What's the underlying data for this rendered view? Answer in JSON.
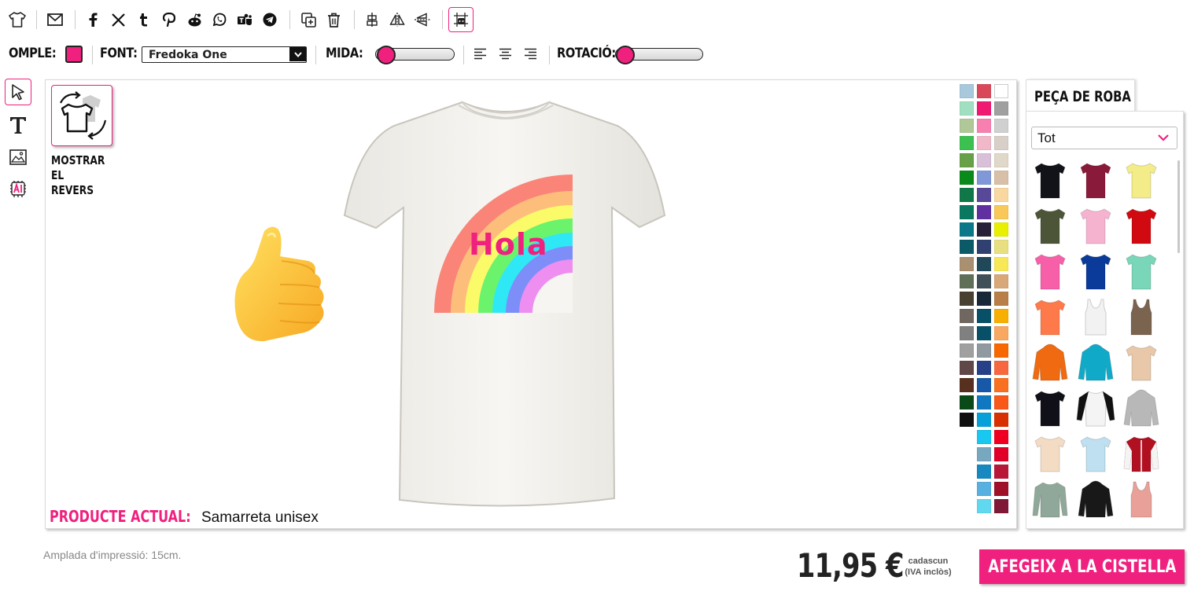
{
  "toolbar2": {
    "fill_label": "OMPLE:",
    "fill_color": "#f0207f",
    "font_label": "FONT:",
    "font_value": "Fredoka One",
    "size_label": "MIDA:",
    "rotation_label": "ROTACIÓ:"
  },
  "canvas": {
    "show_back_label_1": "MOSTRAR",
    "show_back_label_2": "EL REVERS",
    "design_text": "Hola",
    "current_product_label": "PRODUCTE ACTUAL:",
    "current_product_name": "Samarreta unisex"
  },
  "swatches": {
    "col1": [
      "#a8c8dc",
      "#a0e0c0",
      "#b0c898",
      "#3cc050",
      "#68a048",
      "#0a8a1a",
      "#107848",
      "#0a7860",
      "#0a7888",
      "#0a5a68",
      "#a89070",
      "#607058",
      "#484030",
      "#706860",
      "#808080",
      "#a0a0a0",
      "#604848",
      "#583020",
      "#0a4a18",
      "#101010"
    ],
    "col2": [
      "#d84858",
      "#f01870",
      "#f880b0",
      "#f0b8c8",
      "#d8c0d8",
      "#8098d8",
      "#584898",
      "#6030a0",
      "#282038",
      "#304070",
      "#204858",
      "#405058",
      "#182838",
      "#085068",
      "#085068",
      "#9098a0",
      "#284088",
      "#1858a8",
      "#1078c0",
      "#08a0d8",
      "#18c8f0",
      "#78a8c0",
      "#1888c0",
      "#58b0e0",
      "#60d8f0"
    ],
    "col3": [
      "#ffffff",
      "#a0a0a0",
      "#d0d0d0",
      "#d8d0c8",
      "#e0d8c8",
      "#d8c0a8",
      "#f8d8a0",
      "#f8c858",
      "#e8f000",
      "#e8e080",
      "#f8e858",
      "#d8a878",
      "#b88048",
      "#f8b000",
      "#f8a860",
      "#f86800",
      "#f86840",
      "#f87020",
      "#f85818",
      "#d83000",
      "#f00020",
      "#e00028",
      "#b81838",
      "#a01028",
      "#801838"
    ]
  },
  "panel": {
    "tab_label": "PEÇA DE ROBA",
    "filter_value": "Tot"
  },
  "footer": {
    "print_width": "Amplada d'impressió: 15cm.",
    "price": "11,95 €",
    "price_note_1": "cadascun",
    "price_note_2": "(IVA inclòs)",
    "add_to_cart": "AFEGEIX A LA CISTELLA"
  },
  "colors": {
    "accent": "#f0207f"
  },
  "icons": {
    "toolbar": [
      "shirt-icon",
      "mail-icon",
      "facebook-icon",
      "x-icon",
      "tumblr-icon",
      "pinterest-icon",
      "reddit-icon",
      "whatsapp-icon",
      "teams-icon",
      "telegram-icon",
      "duplicate-icon",
      "trash-icon",
      "center-vertical-icon",
      "flip-horizontal-icon",
      "flip-vertical-icon",
      "grid-icon"
    ],
    "tools": [
      "cursor-icon",
      "text-icon",
      "image-icon",
      "ai-icon"
    ]
  }
}
